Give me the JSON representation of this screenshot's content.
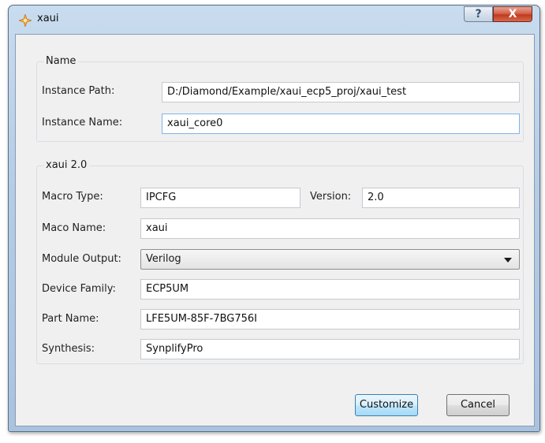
{
  "window": {
    "title": "xaui",
    "help_label": "?",
    "close_label": "X"
  },
  "name_group": {
    "title": "Name",
    "instance_path_label": "Instance Path:",
    "instance_path_value": "D:/Diamond/Example/xaui_ecp5_proj/xaui_test",
    "instance_name_label": "Instance Name:",
    "instance_name_value": "xaui_core0"
  },
  "xaui_group": {
    "title": "xaui 2.0",
    "macro_type_label": "Macro Type:",
    "macro_type_value": "IPCFG",
    "version_label": "Version:",
    "version_value": "2.0",
    "maco_name_label": "Maco Name:",
    "maco_name_value": "xaui",
    "module_output_label": "Module Output:",
    "module_output_value": "Verilog",
    "device_family_label": "Device Family:",
    "device_family_value": "ECP5UM",
    "part_name_label": "Part Name:",
    "part_name_value": "LFE5UM-85F-7BG756I",
    "synthesis_label": "Synthesis:",
    "synthesis_value": "SynplifyPro"
  },
  "buttons": {
    "customize_label": "Customize",
    "cancel_label": "Cancel"
  },
  "icons": {
    "app_icon": "diamond-app-icon",
    "help_icon": "question-icon",
    "close_icon": "close-icon",
    "dropdown_icon": "chevron-down-icon"
  },
  "colors": {
    "title_bar": "#b5cde6",
    "close_button": "#c2391f",
    "focus_border": "#7eb4ea",
    "default_button": "#3c7fb1"
  }
}
